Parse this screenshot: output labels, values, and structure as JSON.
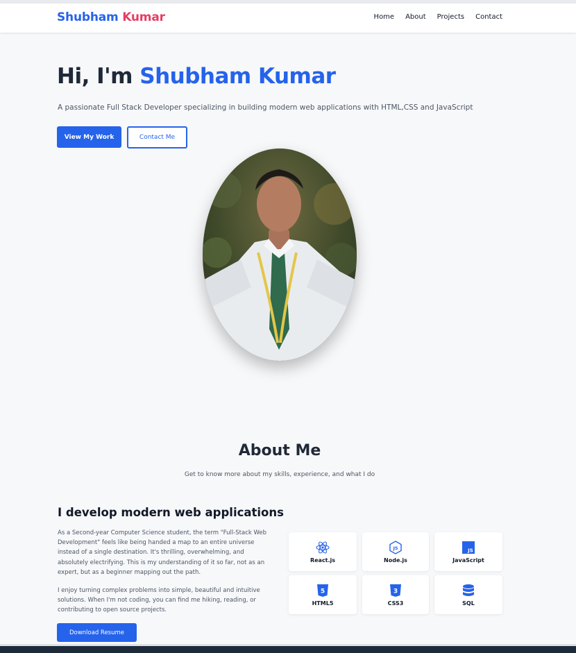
{
  "brand": {
    "first": "Shubham",
    "last": "Kumar"
  },
  "nav": [
    "Home",
    "About",
    "Projects",
    "Contact"
  ],
  "hero": {
    "greeting": "Hi, I'm",
    "name": "Shubham Kumar",
    "subtitle": "A passionate Full Stack Developer specializing in building modern web applications with HTML,CSS and JavaScript",
    "primary_button": "View My Work",
    "secondary_button": "Contact Me"
  },
  "about": {
    "title": "About Me",
    "subtitle": "Get to know more about my skills, experience, and what I do",
    "heading": "I develop modern web applications",
    "paragraph1": "As a Second-year Computer Science student, the term \"Full-Stack Web Development\" feels like being handed a map to an entire universe instead of a single destination. It's thrilling, overwhelming, and absolutely electrifying. This is my understanding of it so far, not as an expert, but as a beginner mapping out the path.",
    "paragraph2": "I enjoy turning complex problems into simple, beautiful and intuitive solutions. When I'm not coding, you can find me hiking, reading, or contributing to open source projects.",
    "resume_button": "Download Resume"
  },
  "skills": [
    {
      "label": "React.js",
      "icon": "react-icon"
    },
    {
      "label": "Node.js",
      "icon": "nodejs-icon"
    },
    {
      "label": "JavaScript",
      "icon": "javascript-icon"
    },
    {
      "label": "HTML5",
      "icon": "html5-icon"
    },
    {
      "label": "CSS3",
      "icon": "css3-icon"
    },
    {
      "label": "SQL",
      "icon": "database-icon"
    }
  ],
  "colors": {
    "accent": "#2563eb",
    "brand_secondary": "#e53e63",
    "background": "#f7f8fa"
  }
}
